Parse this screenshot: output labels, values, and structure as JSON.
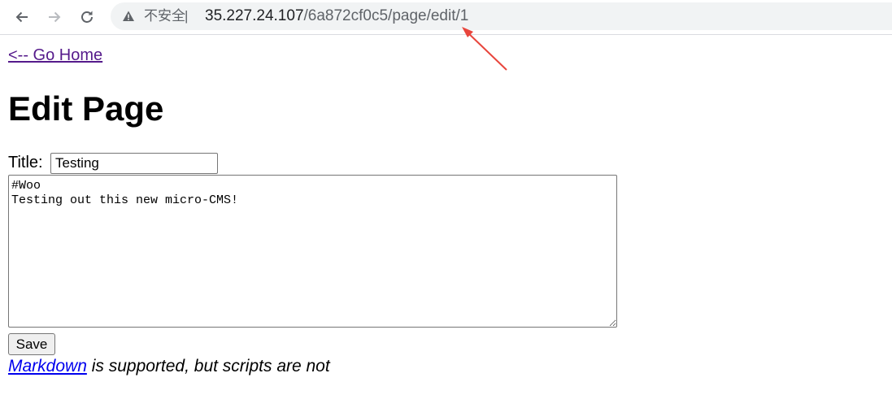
{
  "browser": {
    "security_label": "不安全",
    "separator": "|",
    "url_host": "35.227.24.107",
    "url_path": "/6a872cf0c5/page/edit/1",
    "icons": {
      "back": "arrow-left-icon",
      "forward": "arrow-right-icon",
      "reload": "reload-icon",
      "warning": "warning-triangle-icon"
    }
  },
  "annotation": {
    "arrow_color": "#e8453c"
  },
  "page": {
    "home_link": "<-- Go Home",
    "heading": "Edit Page",
    "title_label": "Title:",
    "title_value": "Testing",
    "body_value": "#Woo\nTesting out this new micro-CMS!",
    "save_label": "Save",
    "note_link": "Markdown",
    "note_text": " is supported, but scripts are not"
  },
  "colors": {
    "visited_link": "#551a8b",
    "link": "#0000ee",
    "omnibox_bg": "#f1f3f4"
  }
}
